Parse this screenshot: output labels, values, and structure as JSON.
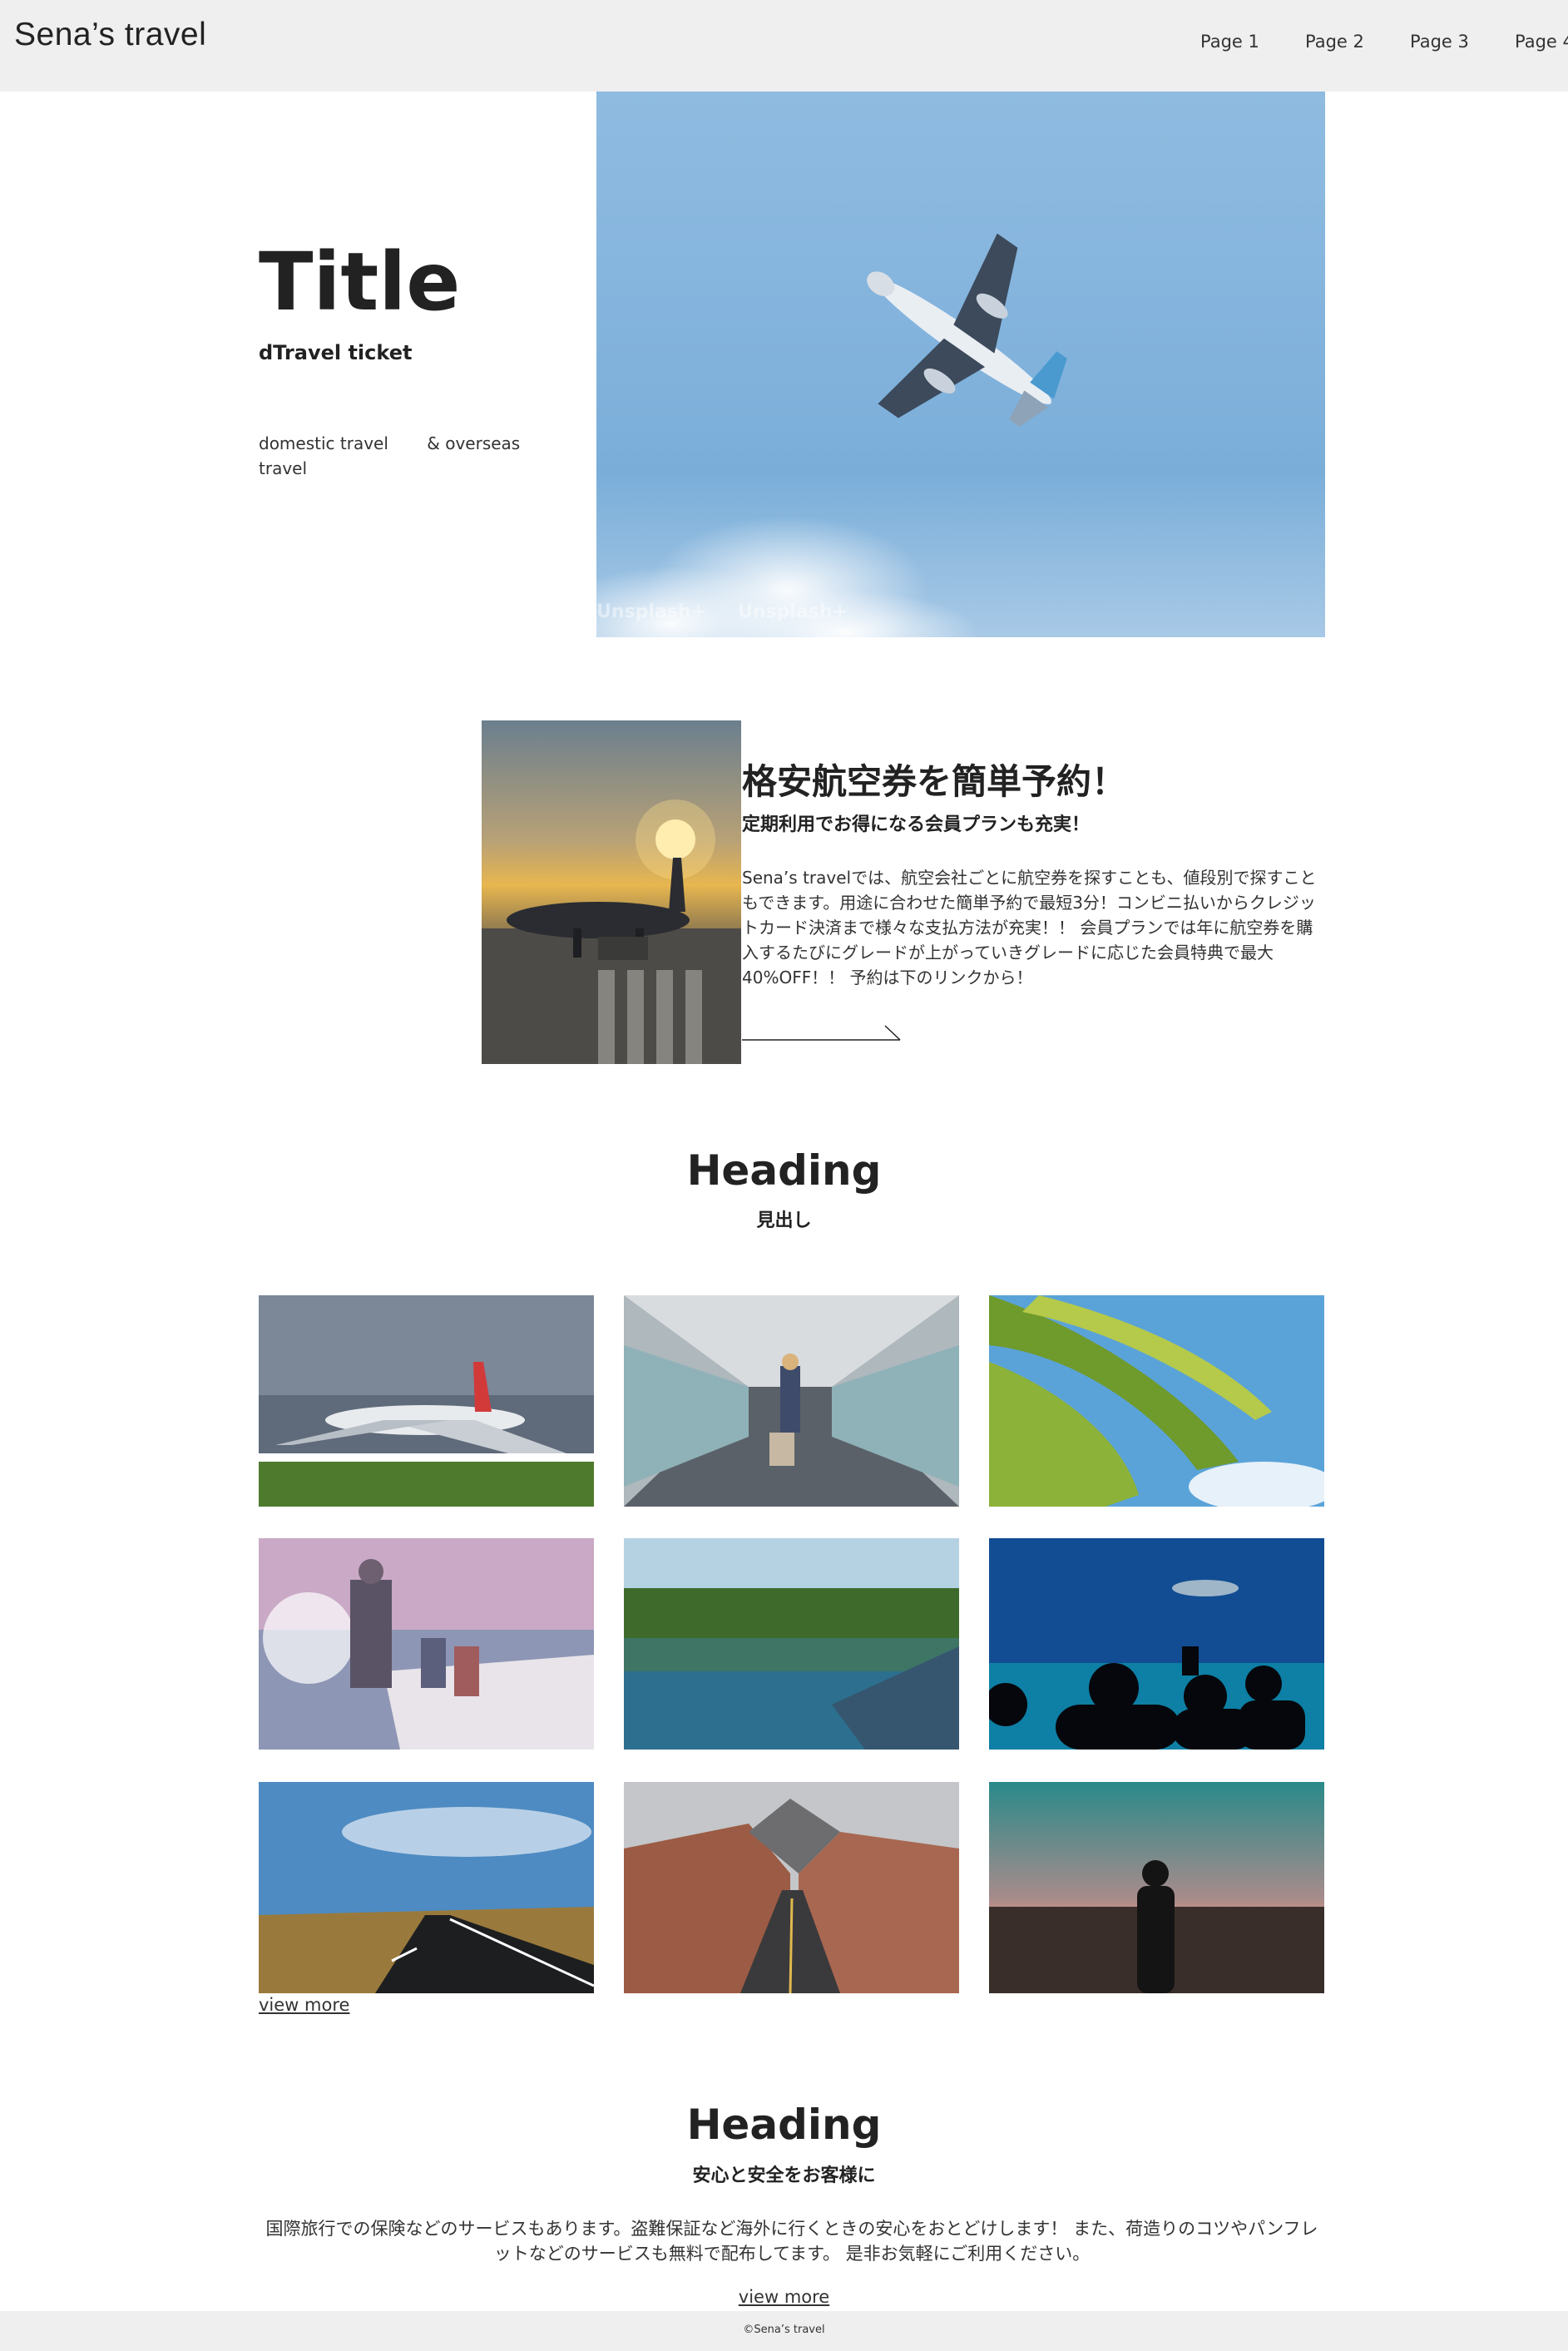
{
  "header": {
    "brand": "Sena’s travel",
    "nav": [
      "Page 1",
      "Page 2",
      "Page 3",
      "Page 4"
    ]
  },
  "hero": {
    "title": "Title",
    "subtitle": "dTravel ticket",
    "description": "domestic travel　　 & overseas travel",
    "watermark": "Unsplash+"
  },
  "feature": {
    "title": "格安航空券を簡単予約！",
    "subtitle": "定期利用でお得になる会員プランも充実！",
    "body": "Sena’s travelでは、航空会社ごとに航空券を探すことも、値段別で探すこともできます。用途に合わせた簡単予約で最短3分！コンビニ払いからクレジットカード決済まで様々な支払方法が充実！！ 会員プランでは年に航空券を購入するたびにグレードが上がっていきグレードに応じた会員特典で最大40%OFF！！ 予約は下のリンクから！"
  },
  "gallery": {
    "heading": "Heading",
    "subheading": "見出し",
    "view_more": "view more",
    "images": [
      "airplane-takeoff-photo",
      "airport-walkway-photo",
      "palm-leaves-photo",
      "family-boat-photo",
      "lake-canoe-photo",
      "aquarium-photo",
      "highway-photo",
      "canyon-road-photo",
      "sunset-silhouette-photo"
    ]
  },
  "info": {
    "heading": "Heading",
    "subheading": "安心と安全をお客様に",
    "body": "国際旅行での保険などのサービスもあります。盗難保証など海外に行くときの安心をおとどけします！ また、荷造りのコツやパンフレットなどのサービスも無料で配布してます。 是非お気軽にご利用ください。",
    "view_more": "view more"
  },
  "footer": {
    "copyright": "©Sena’s travel"
  },
  "colors": {
    "header_bg": "#efefef",
    "text": "#222222",
    "sky": "#84b4dd"
  }
}
